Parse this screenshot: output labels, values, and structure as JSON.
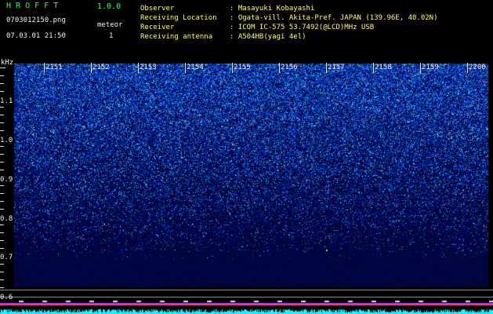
{
  "app": {
    "title": "H R O F F T",
    "version": "1.0.0"
  },
  "file": {
    "name": "0703012150.png",
    "datetime": "07.03.01 21:50"
  },
  "detector": {
    "label": "meteor",
    "count": "1"
  },
  "info": [
    {
      "label": "Observer",
      "value": ": Masayuki Kobayashi"
    },
    {
      "label": "Receiving Location",
      "value": ": Ogata-vill. Akita-Pref. JAPAN (139.96E, 40.02N)"
    },
    {
      "label": "Receiver",
      "value": ": ICOM IC-575 53.7492(@LCD)MHz USB"
    },
    {
      "label": "Receiving antenna",
      "value": ": A504HB(yagi 4el)"
    }
  ],
  "spectrogram": {
    "y_unit": "kHz",
    "y_ticks": [
      "1.1",
      "1.0",
      "0.9",
      "0.8",
      "0.7",
      "0.6"
    ],
    "time_labels": [
      "2151",
      "2152",
      "2153",
      "2154",
      "2155",
      "2156",
      "2157",
      "2158",
      "2159",
      "2200"
    ]
  },
  "colors": {
    "background": "#000000",
    "title": "#39ff39",
    "label": "#ffff70",
    "text": "#f2f2f2",
    "noise_dark": "#0a1a6a",
    "noise_bright": "#35a0ff",
    "baseline": "#c040ff",
    "meteor_blip": "#1cf0ff"
  }
}
